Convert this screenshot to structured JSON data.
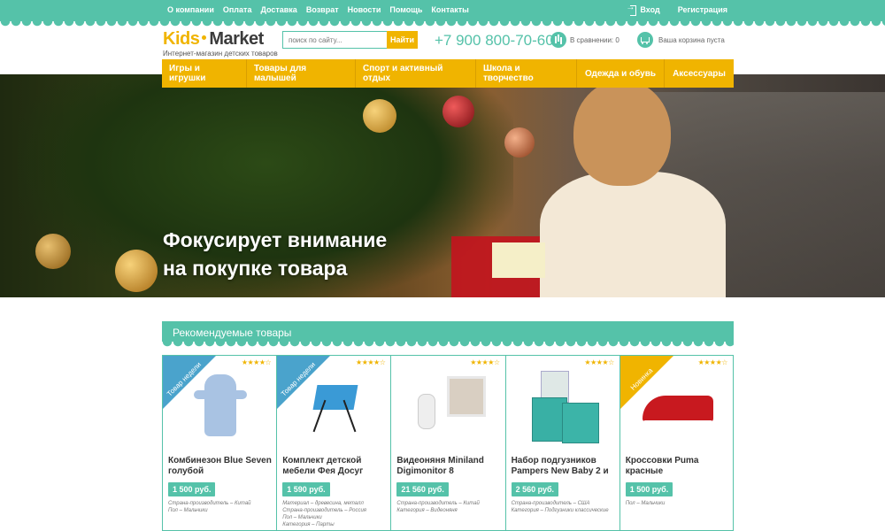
{
  "topnav": {
    "items": [
      "О компании",
      "Оплата",
      "Доставка",
      "Возврат",
      "Новости",
      "Помощь",
      "Контакты"
    ],
    "login": "Вход",
    "register": "Регистрация"
  },
  "header": {
    "logo_part1": "Kids",
    "logo_part2": "Market",
    "tagline": "Интернет-магазин детских товаров",
    "search_placeholder": "поиск по сайту...",
    "search_button": "Найти",
    "phone": "+7 900 800-70-60",
    "compare_text": "В сравнении: 0",
    "cart_text": "Ваша корзина пуста"
  },
  "categories": [
    "Игры и игрушки",
    "Товары для малышей",
    "Спорт и активный отдых",
    "Школа и творчество",
    "Одежда и обувь",
    "Аксессуары"
  ],
  "hero": {
    "line1": "Фокусирует внимание",
    "line2": "на покупке товара"
  },
  "recommended": {
    "title": "Рекомендуемые товары",
    "products": [
      {
        "badge": "Товар недели",
        "badge_color": "#4aa3cc",
        "stars": "★★★★☆",
        "name": "Комбинезон Blue Seven голубой",
        "price": "1 500 руб.",
        "meta": [
          "Страна-производитель – Китай",
          "Пол – Мальчики"
        ]
      },
      {
        "badge": "Товар недели",
        "badge_color": "#4aa3cc",
        "stars": "★★★★☆",
        "name": "Комплект детской мебели Фея Досуг",
        "price": "1 590 руб.",
        "meta": [
          "Материал – древесина, металл",
          "Страна-производитель – Россия",
          "Пол – Мальчики",
          "Категория – Парты"
        ]
      },
      {
        "badge": "",
        "badge_color": "",
        "stars": "★★★★☆",
        "name": "Видеоняня Miniland Digimonitor 8",
        "price": "21 560 руб.",
        "meta": [
          "Страна-производитель – Китай",
          "Категория – Видеоняня"
        ]
      },
      {
        "badge": "",
        "badge_color": "",
        "stars": "★★★★☆",
        "name": "Набор подгузников Pampers New Baby 2 и",
        "price": "2 560 руб.",
        "meta": [
          "Страна-производитель – США",
          "Категория – Подгузники классические"
        ]
      },
      {
        "badge": "Новинка",
        "badge_color": "#f0b400",
        "stars": "★★★★☆",
        "name": "Кроссовки Puma красные",
        "price": "1 500 руб.",
        "meta": [
          "Пол – Мальчики"
        ]
      }
    ]
  },
  "colors": {
    "teal": "#55c2a9",
    "yellow": "#f0b400"
  }
}
